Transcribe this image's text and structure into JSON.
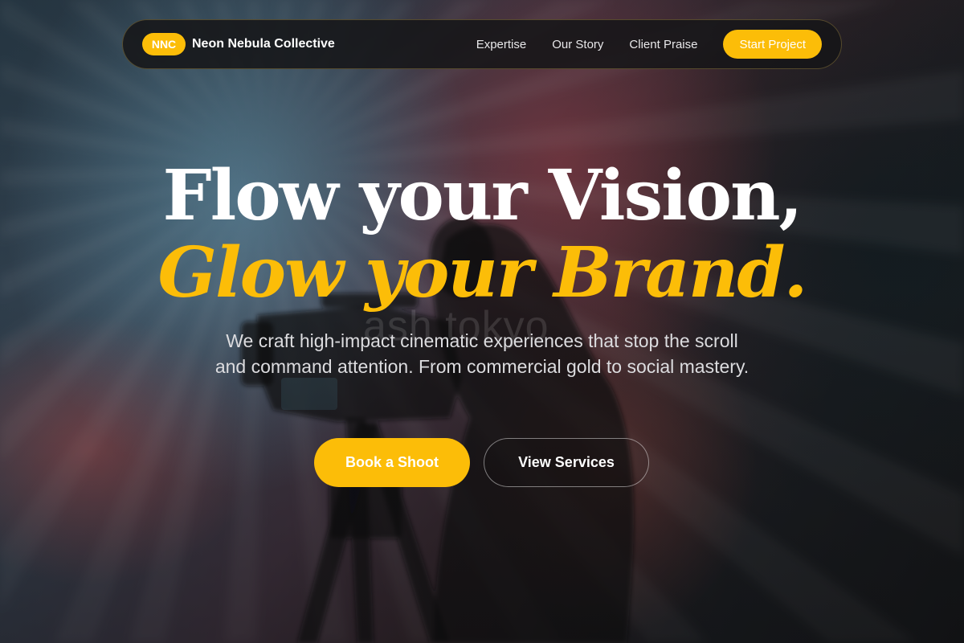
{
  "nav": {
    "logo_badge": "NNC",
    "brand_name": "Neon Nebula Collective",
    "links": [
      "Expertise",
      "Our Story",
      "Client Praise"
    ],
    "cta_label": "Start Project"
  },
  "hero": {
    "headline_line1": "Flow your Vision,",
    "headline_line2": "Glow your Brand.",
    "subtitle": "We craft high-impact cinematic experiences that stop the scroll and command attention. From commercial gold to social mastery.",
    "primary_button": "Book a Shoot",
    "secondary_button": "View Services",
    "watermark_text": "ash tokyo"
  },
  "colors": {
    "accent": "#fcbd08",
    "nav_background": "#161618",
    "text_primary": "#ffffff"
  },
  "icons": {
    "background": "camera-operator-photo"
  }
}
